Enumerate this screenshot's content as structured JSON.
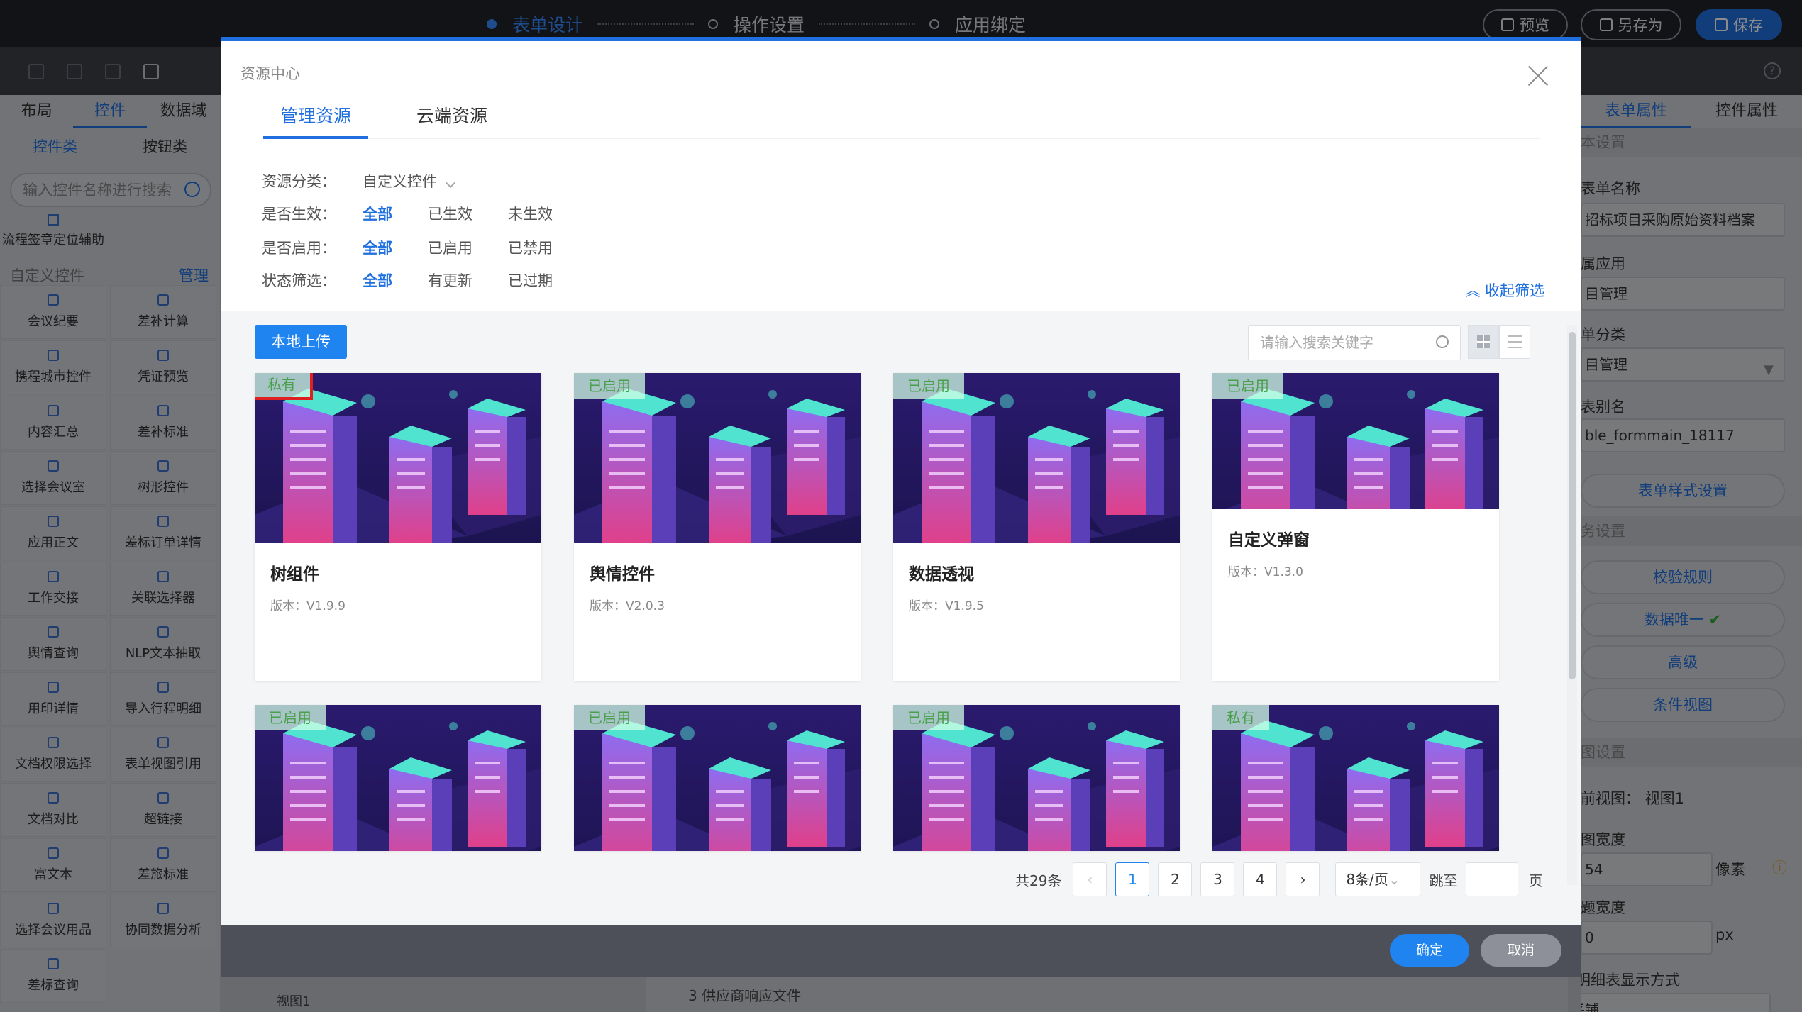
{
  "topbar": {
    "steps": [
      "表单设计",
      "操作设置",
      "应用绑定"
    ],
    "preview_label": "预览",
    "saveas_label": "另存为",
    "save_label": "保存"
  },
  "left_panel": {
    "tabs": [
      "布局",
      "控件",
      "数据域"
    ],
    "subtabs": [
      "控件类",
      "按钮类"
    ],
    "search_placeholder": "输入控件名称进行搜索",
    "flow_item": "流程签章定位辅助",
    "custom_header": "自定义控件",
    "custom_manage": "管理",
    "items": [
      "会议纪要",
      "差补计算",
      "携程城市控件",
      "凭证预览",
      "内容汇总",
      "差补标准",
      "选择会议室",
      "树形控件",
      "应用正文",
      "差标订单详情",
      "工作交接",
      "关联选择器",
      "舆情查询",
      "NLP文本抽取",
      "用印详情",
      "导入行程明细",
      "文档权限选择",
      "表单视图引用",
      "文档对比",
      "超链接",
      "富文本",
      "差旅标准",
      "选择会议用品",
      "协同数据分析",
      "差标查询"
    ]
  },
  "right_panel": {
    "tabs": [
      "表单属性",
      "控件属性"
    ],
    "sec_basic": "本设置",
    "form_name_label": "表单名称",
    "form_name_value": "招标项目采购原始资料档案",
    "app_label": "属应用",
    "app_value": "目管理",
    "category_label": "单分类",
    "category_value": "目管理",
    "alias_label": "表别名",
    "alias_value": "ble_formmain_18117",
    "style_btn": "表单样式设置",
    "sec_business": "务设置",
    "btn_validate": "校验规则",
    "btn_unique": "数据唯一",
    "btn_advanced": "高级",
    "btn_condition": "条件视图",
    "sec_view": "图设置",
    "current_view": "前视图：  视图1",
    "view_width_label": "图宽度",
    "view_width_value": "54",
    "view_width_unit": "像素",
    "col_width_label": "题宽度",
    "col_width_value": "0",
    "col_width_unit": "px",
    "detail_mode_label": "多明细表显示方式",
    "detail_mode_value": "平铺"
  },
  "canvas": {
    "row_text": "3  供应商响应文件",
    "bottom_tab": "视图1"
  },
  "modal": {
    "title": "资源中心",
    "tabs": [
      "管理资源",
      "云端资源"
    ],
    "filters": {
      "category_label": "资源分类：",
      "category_value": "自定义控件",
      "effective_label": "是否生效：",
      "effective_options": [
        "全部",
        "已生效",
        "未生效"
      ],
      "enabled_label": "是否启用：",
      "enabled_options": [
        "全部",
        "已启用",
        "已禁用"
      ],
      "status_label": "状态筛选：",
      "status_options": [
        "全部",
        "有更新",
        "已过期"
      ]
    },
    "collapse_label": "收起筛选",
    "upload_label": "本地上传",
    "search_placeholder": "请输入搜索关键字",
    "cards": [
      {
        "tag": "私有",
        "name": "树组件",
        "version": "版本：V1.9.9"
      },
      {
        "tag": "已启用",
        "name": "舆情控件",
        "version": "版本：V2.0.3"
      },
      {
        "tag": "已启用",
        "name": "数据透视",
        "version": "版本：V1.9.5"
      },
      {
        "tag": "已启用",
        "name": "自定义弹窗",
        "version": "版本：V1.3.0"
      },
      {
        "tag": "已启用",
        "name": "",
        "version": ""
      },
      {
        "tag": "已启用",
        "name": "",
        "version": ""
      },
      {
        "tag": "已启用",
        "name": "",
        "version": ""
      },
      {
        "tag": "私有",
        "name": "",
        "version": ""
      }
    ],
    "pagination": {
      "total": "共29条",
      "pages": [
        "1",
        "2",
        "3",
        "4"
      ],
      "page_size": "8条/页",
      "jump_label": "跳至",
      "page_unit": "页"
    },
    "confirm_label": "确定",
    "cancel_label": "取消"
  },
  "colors": {
    "accent": "#1f6fe0",
    "tag_green": "#4aa04a",
    "highlight_red": "#e02020"
  }
}
